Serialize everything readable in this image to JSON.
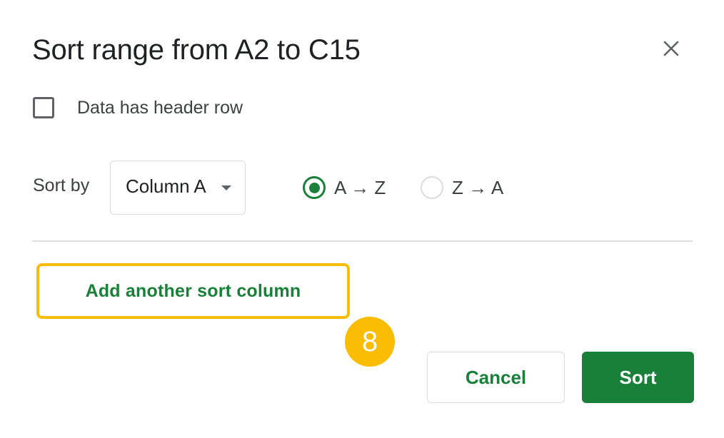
{
  "dialog": {
    "title": "Sort range from A2 to C15",
    "close_icon": "close-icon"
  },
  "header_option": {
    "label": "Data has header row",
    "checked": false
  },
  "sort_rule": {
    "label": "Sort by",
    "column": {
      "selected": "Column A",
      "caret_icon": "caret-down-icon"
    },
    "order_options": [
      {
        "label": "A → Z",
        "checked": true
      },
      {
        "label": "Z → A",
        "checked": false
      }
    ]
  },
  "add_sort_column": {
    "label": "Add another sort column",
    "highlighted": true
  },
  "annotation": {
    "step_number": "8",
    "color": "#fbbc04"
  },
  "actions": {
    "cancel_label": "Cancel",
    "sort_label": "Sort"
  },
  "colors": {
    "accent_green": "#188038",
    "highlight_yellow": "#fbbc04",
    "border_gray": "#dadce0",
    "text_dark": "#202124"
  }
}
